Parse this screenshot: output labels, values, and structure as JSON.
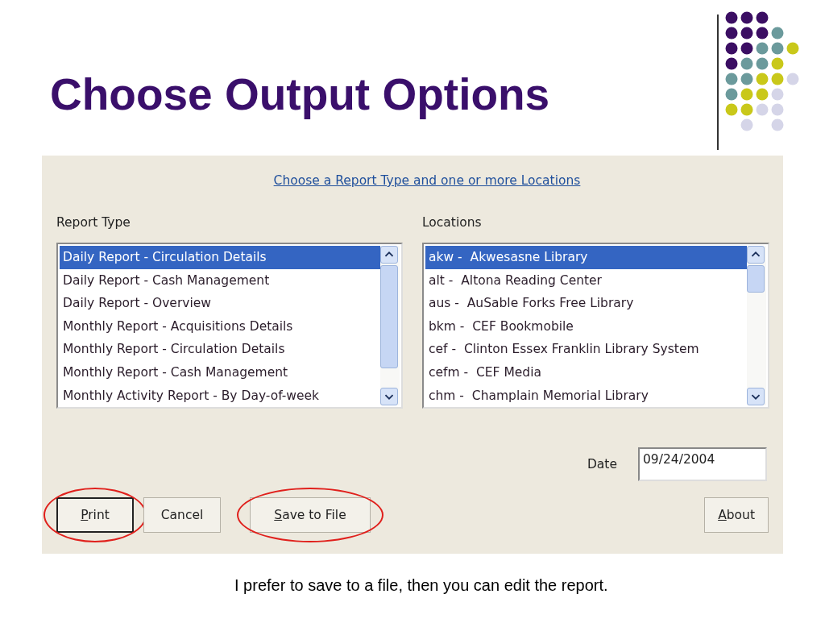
{
  "slide": {
    "title": "Choose Output Options",
    "caption": "I prefer to save to a file, then you can edit the report."
  },
  "dialog": {
    "link": "Choose a Report Type and one or more Locations",
    "report_type": {
      "label": "Report Type",
      "items": [
        {
          "text": "Daily Report - Circulation Details",
          "selected": true
        },
        {
          "text": "Daily Report - Cash Management",
          "selected": false
        },
        {
          "text": "Daily Report - Overview",
          "selected": false
        },
        {
          "text": "Monthly Report - Acquisitions Details",
          "selected": false
        },
        {
          "text": "Monthly Report - Circulation Details",
          "selected": false
        },
        {
          "text": "Monthly Report - Cash Management",
          "selected": false
        },
        {
          "text": "Monthly Activity Report - By Day-of-week",
          "selected": false
        }
      ]
    },
    "locations": {
      "label": "Locations",
      "items": [
        {
          "text": "akw -  Akwesasne Library",
          "selected": true
        },
        {
          "text": "alt -  Altona Reading Center",
          "selected": false
        },
        {
          "text": "aus -  AuSable Forks Free Library",
          "selected": false
        },
        {
          "text": "bkm -  CEF Bookmobile",
          "selected": false
        },
        {
          "text": "cef -  Clinton Essex Franklin Library System",
          "selected": false
        },
        {
          "text": "cefm -  CEF Media",
          "selected": false
        },
        {
          "text": "chm -  Champlain Memorial Library",
          "selected": false
        }
      ]
    },
    "date": {
      "label": "Date",
      "value": "09/24/2004"
    },
    "buttons": [
      {
        "label": "Print",
        "mnemonic": true,
        "default": true,
        "circled": true
      },
      {
        "label": "Cancel",
        "mnemonic": false,
        "default": false,
        "circled": false
      },
      {
        "label": "Save to File",
        "mnemonic": true,
        "default": false,
        "circled": true
      }
    ],
    "about_button": {
      "label": "About",
      "mnemonic": true
    }
  }
}
